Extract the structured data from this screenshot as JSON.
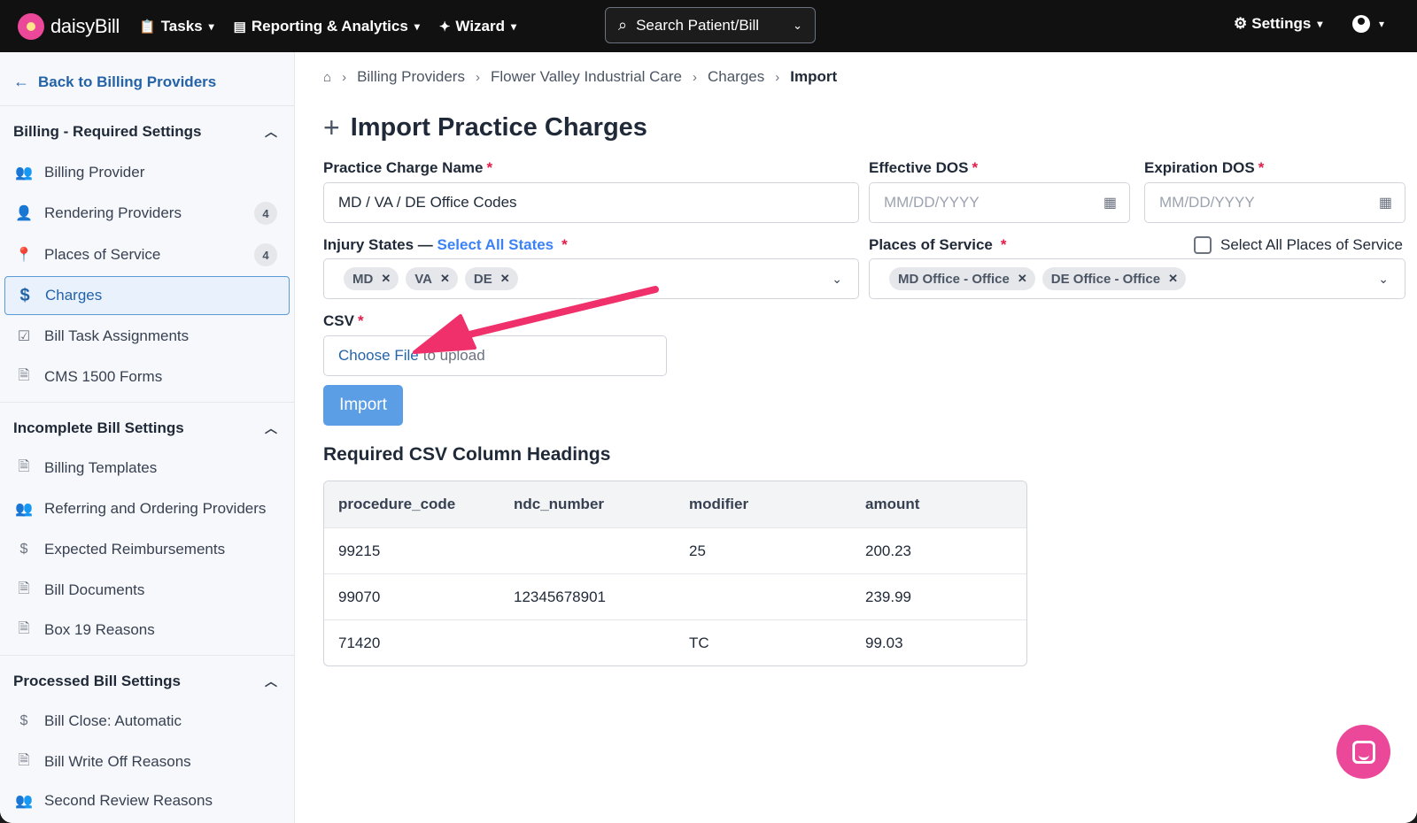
{
  "topnav": {
    "logo_text": "daisyBill",
    "tasks": "Tasks",
    "reporting": "Reporting & Analytics",
    "wizard": "Wizard",
    "search_placeholder": "Search Patient/Bill",
    "settings": "Settings"
  },
  "sidebar": {
    "back_label": "Back to Billing Providers",
    "sections": [
      {
        "title": "Billing - Required Settings",
        "items": [
          {
            "label": "Billing Provider",
            "icon": "users-icon"
          },
          {
            "label": "Rendering Providers",
            "icon": "user-badge-icon",
            "badge": "4"
          },
          {
            "label": "Places of Service",
            "icon": "map-pin-icon",
            "badge": "4"
          },
          {
            "label": "Charges",
            "icon": "dollar-icon",
            "active": true
          },
          {
            "label": "Bill Task Assignments",
            "icon": "clipboard-check-icon"
          },
          {
            "label": "CMS 1500 Forms",
            "icon": "document-icon"
          }
        ]
      },
      {
        "title": "Incomplete Bill Settings",
        "items": [
          {
            "label": "Billing Templates",
            "icon": "document-icon"
          },
          {
            "label": "Referring and Ordering Providers",
            "icon": "users-icon"
          },
          {
            "label": "Expected Reimbursements",
            "icon": "dollar-icon"
          },
          {
            "label": "Bill Documents",
            "icon": "document-icon"
          },
          {
            "label": "Box 19 Reasons",
            "icon": "document-icon"
          }
        ]
      },
      {
        "title": "Processed Bill Settings",
        "items": [
          {
            "label": "Bill Close: Automatic",
            "icon": "dollar-icon"
          },
          {
            "label": "Bill Write Off Reasons",
            "icon": "document-icon"
          },
          {
            "label": "Second Review Reasons",
            "icon": "users-icon"
          }
        ]
      }
    ]
  },
  "breadcrumb": [
    "Billing Providers",
    "Flower Valley Industrial Care",
    "Charges",
    "Import"
  ],
  "page_title": "Import Practice Charges",
  "form": {
    "charge_name_label": "Practice Charge Name",
    "charge_name_value": "MD / VA / DE Office Codes",
    "effective_label": "Effective DOS",
    "effective_placeholder": "MM/DD/YYYY",
    "expiration_label": "Expiration DOS",
    "expiration_placeholder": "MM/DD/YYYY",
    "injury_label": "Injury States — ",
    "select_all_states": "Select All States",
    "injury_tags": [
      "MD",
      "VA",
      "DE"
    ],
    "pos_label": "Places of Service",
    "select_all_pos": "Select All Places of Service",
    "pos_tags": [
      "MD Office - Office",
      "DE Office - Office"
    ],
    "csv_label": "CSV",
    "choose_file": "Choose File",
    "to_upload": "to upload",
    "import_button": "Import",
    "required_mark": "*"
  },
  "csv_section": {
    "title": "Required CSV Column Headings",
    "headers": [
      "procedure_code",
      "ndc_number",
      "modifier",
      "amount"
    ],
    "rows": [
      [
        "99215",
        "",
        "25",
        "200.23"
      ],
      [
        "99070",
        "12345678901",
        "",
        "239.99"
      ],
      [
        "71420",
        "",
        "TC",
        "99.03"
      ]
    ]
  },
  "colors": {
    "accent": "#2563a8",
    "brand_pink": "#ec4899",
    "annotation_arrow": "#f0306b",
    "import_button": "#5b9ee6"
  }
}
